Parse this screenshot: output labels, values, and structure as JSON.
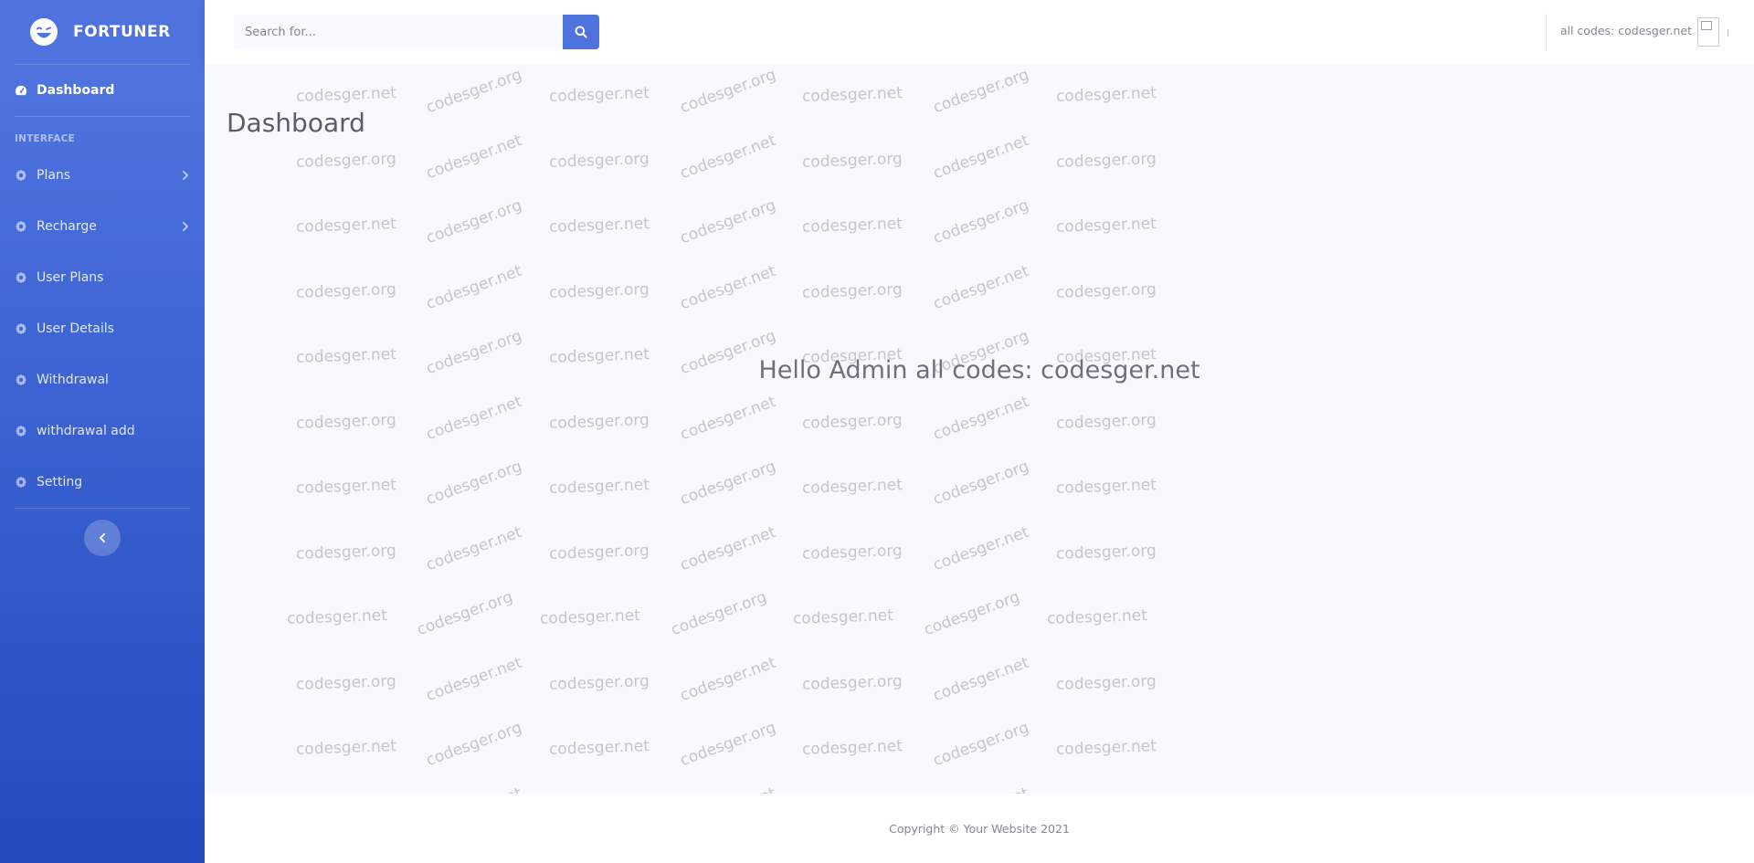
{
  "sidebar": {
    "brand": "FORTUNER",
    "dashboard": "Dashboard",
    "heading": "INTERFACE",
    "items": [
      {
        "label": "Plans",
        "chevron": true
      },
      {
        "label": "Recharge",
        "chevron": true
      },
      {
        "label": "User Plans",
        "chevron": false
      },
      {
        "label": "User Details",
        "chevron": false
      },
      {
        "label": "Withdrawal",
        "chevron": false
      },
      {
        "label": "withdrawal add",
        "chevron": false
      },
      {
        "label": "Setting",
        "chevron": false
      }
    ],
    "icons": {
      "brand": "laugh-wink-icon",
      "dashboard": "tachometer-icon",
      "item": "cog-icon",
      "chevron": "chevron-right-icon",
      "toggle": "chevron-left-icon"
    }
  },
  "topbar": {
    "search_placeholder": "Search for...",
    "user_name": "all codes: codesger.net"
  },
  "main": {
    "title": "Dashboard",
    "message": "Hello Admin all codes: codesger.net",
    "watermarks": [
      "codesger.net",
      "codesger.org"
    ]
  },
  "footer": {
    "copyright": "Copyright © Your Website 2021"
  },
  "colors": {
    "primary": "#4e73df",
    "primary_dark": "#224abe",
    "page_bg": "#f8f9fc",
    "text": "#5a5c69"
  }
}
